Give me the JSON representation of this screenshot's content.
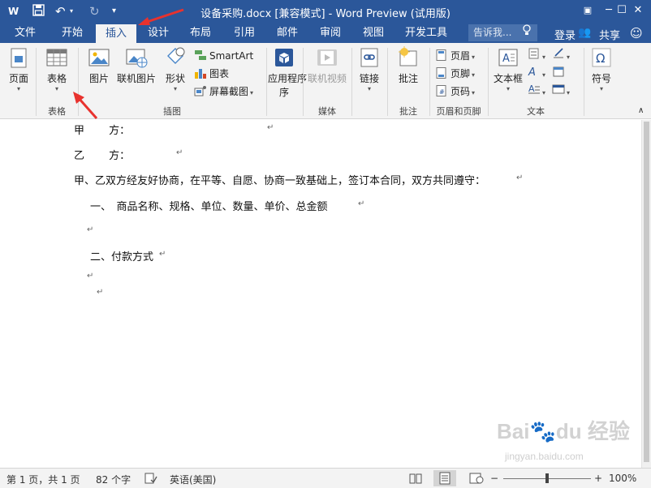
{
  "titlebar": {
    "title": "设备采购.docx [兼容模式] - Word Preview (试用版)",
    "qat": [
      "word-icon",
      "save-icon",
      "undo-icon",
      "redo-icon",
      "customize-icon"
    ],
    "window_buttons": [
      "restore-ribbon-icon",
      "minimize-icon",
      "maximize-icon",
      "close-icon"
    ]
  },
  "tabs": [
    "文件",
    "开始",
    "插入",
    "设计",
    "布局",
    "引用",
    "邮件",
    "审阅",
    "视图",
    "开发工具"
  ],
  "active_tab": "插入",
  "tell_me": "告诉我...",
  "signin": "登录",
  "share": "共享",
  "ribbon": {
    "pages": {
      "label": "页面",
      "group": ""
    },
    "tables": {
      "label": "表格",
      "group": "表格"
    },
    "illustrations": {
      "group": "插图",
      "picture": "图片",
      "online_picture": "联机图片",
      "shapes": "形状",
      "smartart": "SmartArt",
      "chart": "图表",
      "screenshot": "屏幕截图"
    },
    "addins": {
      "label": "应用程序",
      "label2": "序"
    },
    "media": {
      "label": "联机视频",
      "group": "媒体"
    },
    "links": {
      "label": "链接"
    },
    "comments": {
      "label": "批注",
      "group": "批注"
    },
    "header_footer": {
      "group": "页眉和页脚",
      "header": "页眉",
      "footer": "页脚",
      "page_number": "页码"
    },
    "text": {
      "group": "文本",
      "textbox": "文本框"
    },
    "symbols": {
      "label": "符号"
    }
  },
  "document": {
    "lines": [
      "甲　　 方：",
      "乙　　 方：",
      "甲、乙双方经友好协商，在平等、自愿、协商一致基础上，签订本合同，双方共同遵守：",
      "一、　商品名称、规格、单位、数量、单价、总金额",
      "二、付款方式"
    ],
    "para_mark": "↵"
  },
  "status": {
    "page": "第 1 页，共 1 页",
    "words": "82 个字",
    "language": "英语(美国)",
    "zoom": "100%",
    "zoom_level": 100
  },
  "watermark": {
    "logo": "Bai du 经验",
    "url": "jingyan.baidu.com"
  },
  "colors": {
    "title_blue": "#2b579a",
    "ribbon_bg": "#f3f3f3",
    "arrow_red": "#e8322e"
  }
}
